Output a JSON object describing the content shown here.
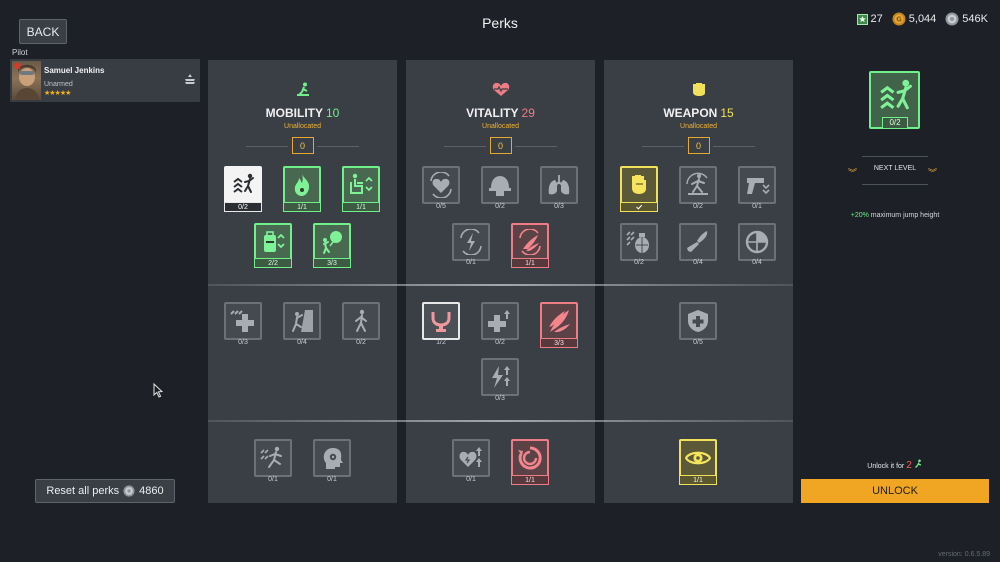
{
  "header": {
    "back_label": "BACK",
    "title": "Perks"
  },
  "currency": {
    "tokens": "27",
    "gold": "5,044",
    "silver": "546K"
  },
  "pilot": {
    "section_label": "Pilot",
    "name": "Samuel Jenkins",
    "status": "Unarmed",
    "stars": "★★★★★"
  },
  "reset": {
    "label": "Reset all perks",
    "cost": "4860"
  },
  "columns": [
    {
      "title": "MOBILITY",
      "points": "10",
      "unallocated_label": "Unallocated",
      "unallocated_value": "0",
      "color": "#6ff08a"
    },
    {
      "title": "VITALITY",
      "points": "29",
      "unallocated_label": "Unallocated",
      "unallocated_value": "0",
      "color": "#ee7c84"
    },
    {
      "title": "WEAPON",
      "points": "15",
      "unallocated_label": "Unallocated",
      "unallocated_value": "0",
      "color": "#f1e15a"
    }
  ],
  "perks": {
    "mobility": [
      "0/2",
      "1/1",
      "1/1",
      "2/2",
      "3/3",
      "0/3",
      "0/4",
      "0/2",
      "0/1",
      "0/1"
    ],
    "vitality": [
      "0/5",
      "0/2",
      "0/3",
      "0/1",
      "1/1",
      "1/2",
      "0/2",
      "3/3",
      "0/3",
      "0/1",
      "1/1"
    ],
    "weapon": [
      "0/2",
      "0/1",
      "0/2",
      "0/4",
      "0/4",
      "0/5",
      "1/1"
    ]
  },
  "detail": {
    "count": "0/2",
    "next_level_label": "NEXT LEVEL",
    "desc_highlight": "+20%",
    "desc_text": " maximum jump height",
    "unlock_for_label": "Unlock it for",
    "unlock_price": "2",
    "unlock_button": "UNLOCK"
  },
  "version": "version: 0.6.5.89"
}
